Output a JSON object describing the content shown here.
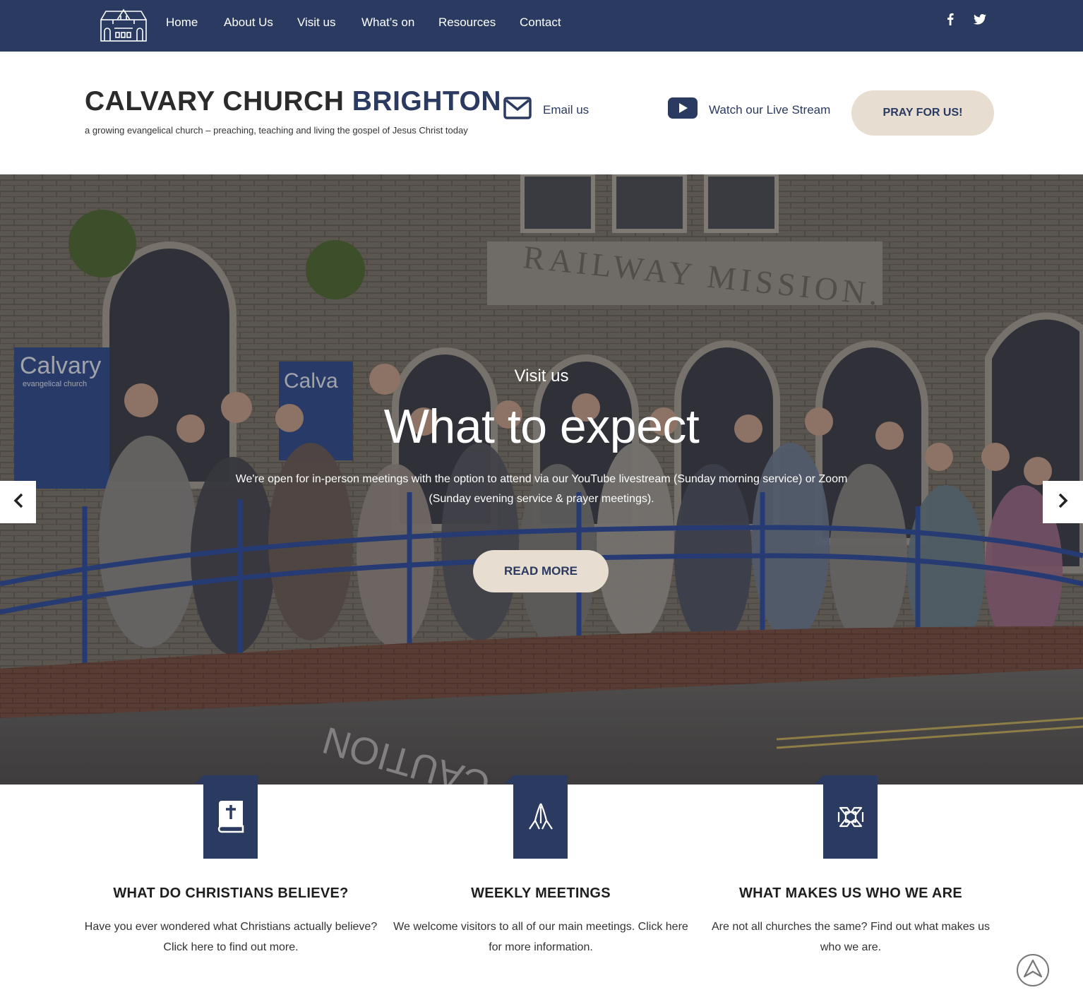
{
  "nav": {
    "logo_icon": "church-building-icon",
    "items": [
      {
        "label": "Home"
      },
      {
        "label": "About Us"
      },
      {
        "label": "Visit us"
      },
      {
        "label": "What’s on"
      },
      {
        "label": "Resources"
      },
      {
        "label": "Contact"
      }
    ],
    "social": [
      {
        "icon": "facebook-icon"
      },
      {
        "icon": "twitter-icon"
      }
    ]
  },
  "header": {
    "title_main": "CALVARY CHURCH ",
    "title_accent": "BRIGHTON",
    "tagline": "a growing evangelical church – preaching, teaching and living the gospel of Jesus Christ today",
    "email_label": "Email us",
    "live_label": "Watch our Live Stream",
    "pray_label": "PRAY FOR US!"
  },
  "hero": {
    "kicker": "Visit us",
    "title": "What to expect",
    "text": "We're open for in-person meetings with the option to attend via our YouTube livestream (Sunday morning service) or Zoom (Sunday evening service & prayer meetings).",
    "button": "READ MORE",
    "photo_text": {
      "building_inscription": "RAILWAY MISSION.",
      "sign_left": "Calvary",
      "sign_left_sub": "evangelical church",
      "sign_right": "Calva",
      "road_marking": "CAUTION"
    }
  },
  "features": [
    {
      "icon": "bible-icon",
      "title": "WHAT DO CHRISTIANS BELIEVE?",
      "text": "Have you ever wondered what Christians actually believe? Click here to find out more."
    },
    {
      "icon": "praying-hands-icon",
      "title": "WEEKLY MEETINGS",
      "text": "We welcome visitors to all of our main meetings. Click here for more information."
    },
    {
      "icon": "joined-hands-icon",
      "title": "WHAT MAKES US WHO WE ARE",
      "text": "Are not all churches the same? Find out what makes us who we are."
    }
  ],
  "colors": {
    "navy": "#2a3a60",
    "beige": "#e7ddd0",
    "white": "#ffffff"
  }
}
